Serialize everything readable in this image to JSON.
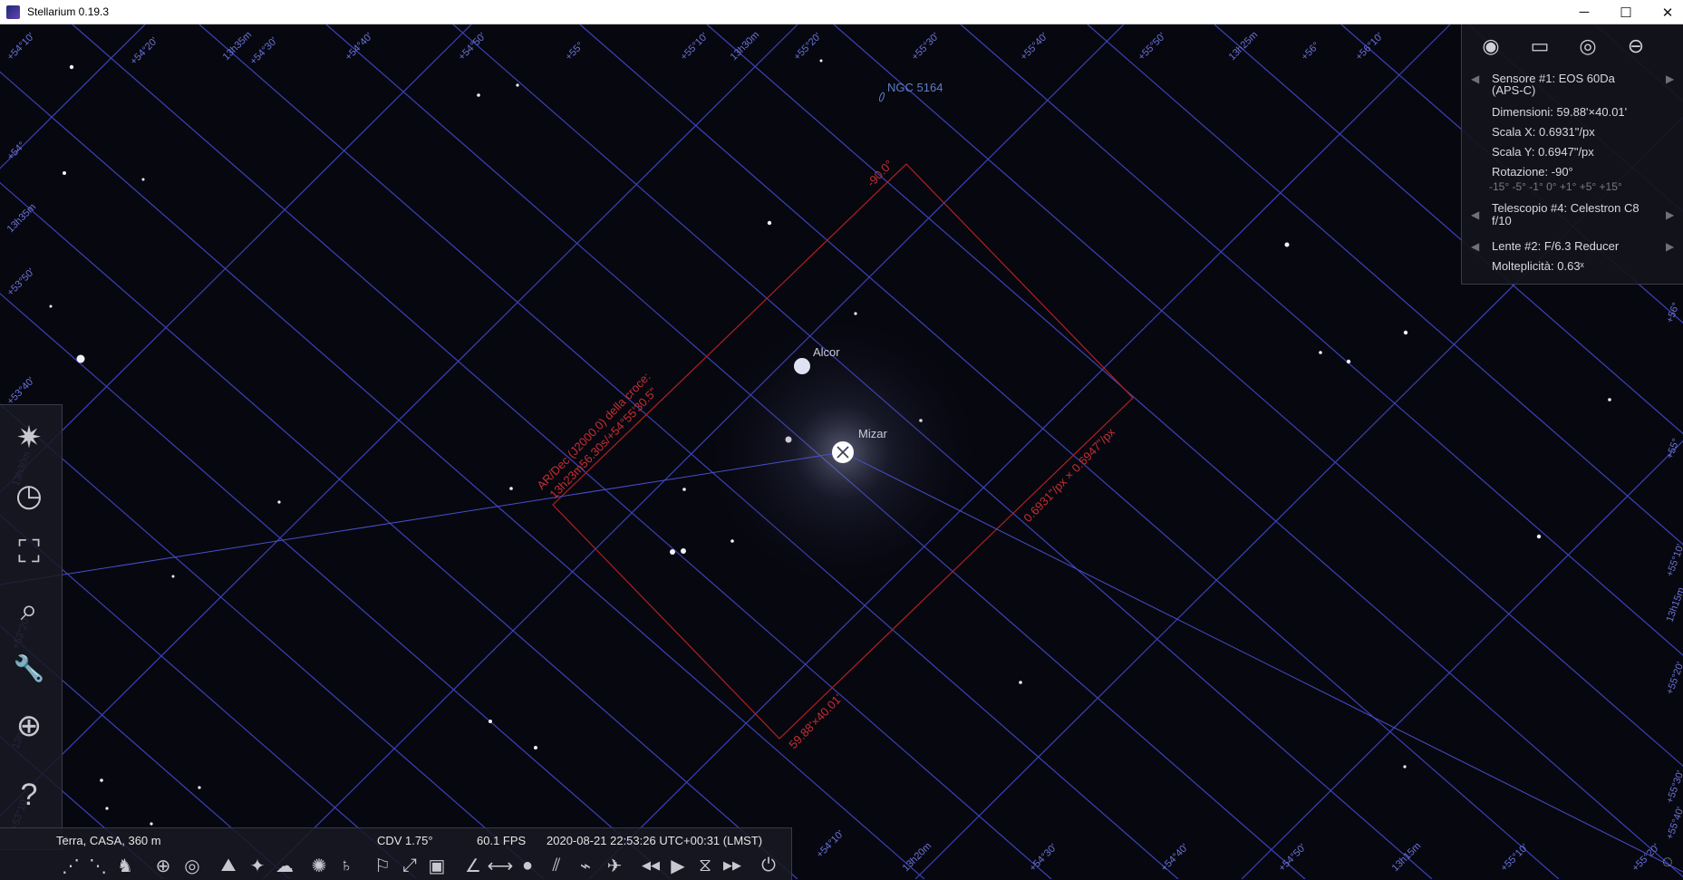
{
  "window": {
    "title": "Stellarium 0.19.3",
    "minimize": "─",
    "maximize": "☐",
    "close": "✕"
  },
  "sky": {
    "objects": [
      {
        "name": "Alcor"
      },
      {
        "name": "Mizar"
      },
      {
        "name": "NGC 5164"
      }
    ],
    "ocular_labels": {
      "rotation": "-90.0°",
      "coords_line1": "AR/Dec (J2000.0) della croce:",
      "coords_line2": "13h23m56.30s/+54°55'30.5\"",
      "scale": "0.6931\"/px × 0.6947\"/px",
      "size": "59.88'×40.01'"
    },
    "grid_labels": [
      "+54°10'",
      "+54°20'",
      "13h35m",
      "+54°30'",
      "+54°40'",
      "+54°50'",
      "+55°",
      "+55°10'",
      "13h30m",
      "+55°20'",
      "+55°30'",
      "+55°40'",
      "+55°50'",
      "13h25m",
      "+56°",
      "+56°10'",
      "+54°",
      "13h35m",
      "+53°50'",
      "+53°40'",
      "+56°",
      "+55°",
      "+55°10'",
      "13h15m",
      "+55°20'",
      "+55°30'",
      "+55°40'",
      "13h30m",
      "+53°20'",
      "13h30m",
      "+53°10'",
      "+54°10'",
      "13h20m",
      "+54°30'",
      "+54°40'",
      "+54°50'",
      "13h15m",
      "+55°10'",
      "+55°20'"
    ]
  },
  "ocular_panel": {
    "buttons": [
      "ocular-icon",
      "sensor-frame-icon",
      "telrad-icon",
      "lens-icon"
    ],
    "sensor": "Sensore #1: EOS 60Da",
    "sensor_type": "(APS-C)",
    "dimensions": "Dimensioni: 59.88'×40.01'",
    "scale_x": "Scala X: 0.6931\"/px",
    "scale_y": "Scala Y: 0.6947\"/px",
    "rotation": "Rotazione: -90°",
    "rotation_presets": "-15° -5° -1° 0° +1° +5° +15°",
    "telescope": "Telescopio #4: Celestron C8",
    "telescope_ratio": "f/10",
    "lens": "Lente #2: F/6.3 Reducer",
    "multiplicity": "Molteplicità: 0.63ˣ"
  },
  "status_bar": {
    "location": "Terra, CASA, 360 m",
    "fov": "CDV 1.75°",
    "fps": "60.1 FPS",
    "datetime": "2020-08-21 22:53:26 UTC+00:31 (LMST)"
  },
  "left_toolbar": {
    "buttons": [
      {
        "name": "sky-and-viewing-options-icon",
        "glyph": "✷"
      },
      {
        "name": "date-time-icon",
        "glyph": "◷"
      },
      {
        "name": "location-icon",
        "glyph": "⛶"
      },
      {
        "name": "search-icon",
        "glyph": "⌕"
      },
      {
        "name": "configuration-icon",
        "glyph": "🔧"
      },
      {
        "name": "astronomical-calculations-icon",
        "glyph": "⊕"
      },
      {
        "name": "help-icon",
        "glyph": "?"
      }
    ]
  },
  "bottom_toolbar": {
    "buttons": [
      {
        "name": "constellation-lines-icon",
        "glyph": "⋰"
      },
      {
        "name": "constellation-names-icon",
        "glyph": "⋱"
      },
      {
        "name": "constellation-art-icon",
        "glyph": "♞"
      },
      {
        "name": "equatorial-grid-icon",
        "glyph": "⊕"
      },
      {
        "name": "azimuthal-grid-icon",
        "glyph": "◎"
      },
      {
        "name": "ground-icon",
        "glyph": "⛰"
      },
      {
        "name": "cardinal-points-icon",
        "glyph": "✦"
      },
      {
        "name": "atmosphere-icon",
        "glyph": "☁"
      },
      {
        "name": "nebulae-icon",
        "glyph": "✺"
      },
      {
        "name": "planets-icon",
        "glyph": "♄"
      },
      {
        "name": "mount-icon",
        "glyph": "⚐"
      },
      {
        "name": "fullscreen-icon",
        "glyph": "⤢"
      },
      {
        "name": "ocular-view-icon",
        "glyph": "▣"
      },
      {
        "name": "angle-measure-icon",
        "glyph": "∠"
      },
      {
        "name": "ruler-icon",
        "glyph": "⟷"
      },
      {
        "name": "exoplanets-icon",
        "glyph": "●"
      },
      {
        "name": "meteor-showers-icon",
        "glyph": "⫽"
      },
      {
        "name": "satellites-icon",
        "glyph": "⌁"
      },
      {
        "name": "satellite-hints-icon",
        "glyph": "✈"
      },
      {
        "name": "rewind-icon",
        "glyph": "◀◀"
      },
      {
        "name": "play-icon",
        "glyph": "▶"
      },
      {
        "name": "now-icon",
        "glyph": "⧖"
      },
      {
        "name": "fast-forward-icon",
        "glyph": "▶▶"
      },
      {
        "name": "quit-icon",
        "glyph": "⏻"
      }
    ]
  },
  "corner_button": {
    "glyph": "◌"
  },
  "colors": {
    "grid": "#3b43b8",
    "ocular_frame": "#b22020",
    "panel_bg": "#14141c"
  }
}
